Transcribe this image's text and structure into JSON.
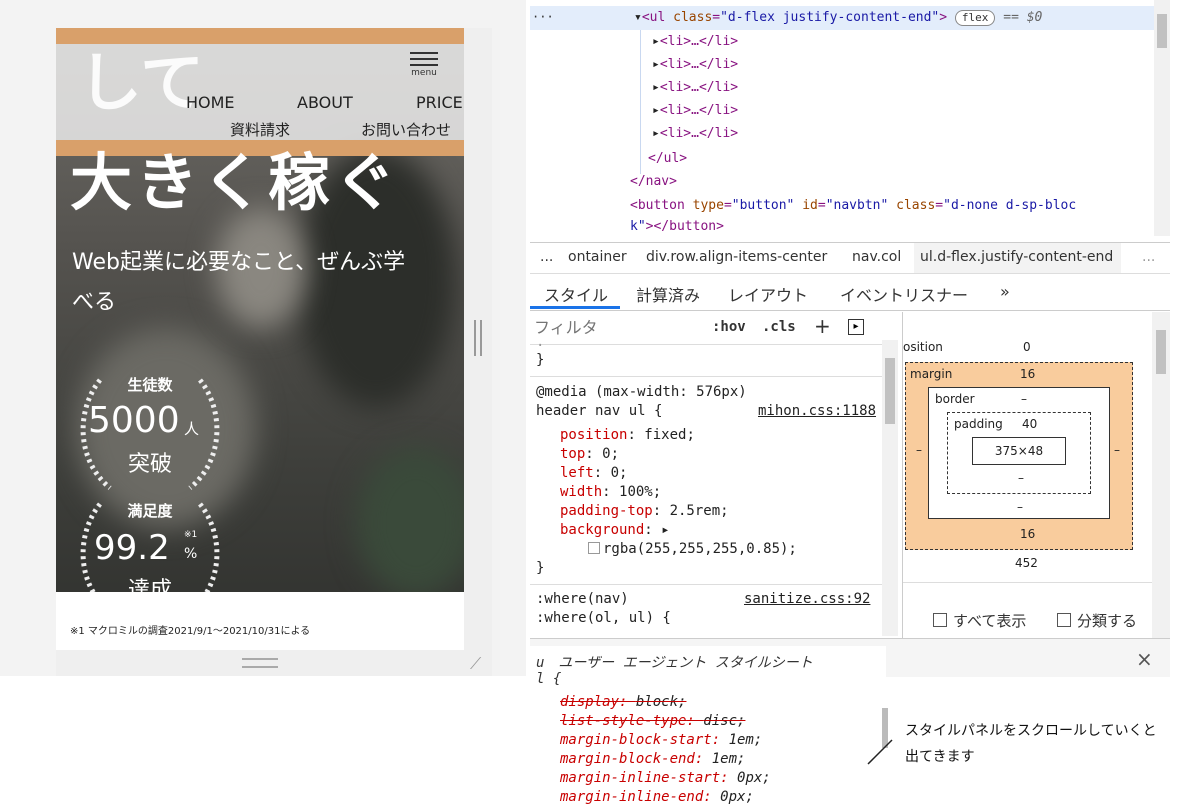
{
  "preview": {
    "hero_line1": "して",
    "hero_line2": "大きく稼ぐ",
    "menu_label": "menu",
    "nav": [
      "HOME",
      "ABOUT",
      "PRICE",
      "資料請求",
      "お問い合わせ"
    ],
    "subtitle_line1": "Web起業に必要なこと、ぜんぶ学",
    "subtitle_line2": "べる",
    "stat1": {
      "label": "生徒数",
      "value": "5000",
      "unit": "人",
      "caption": "突破"
    },
    "stat2": {
      "label": "満足度",
      "value": "99.2",
      "note": "※1",
      "unit": "%",
      "caption": "達成"
    },
    "footnote": "※1 マクロミルの調査2021/9/1～2021/10/31による"
  },
  "devtools": {
    "dom_tree": {
      "dots": "···",
      "ul_open_tag": "ul",
      "ul_class_attr": "class",
      "ul_class_val": "\"d-flex justify-content-end\"",
      "flex_badge": "flex",
      "eq": "== $0",
      "li_items": [
        "<li>…</li>",
        "<li>…</li>",
        "<li>…</li>",
        "<li>…</li>",
        "<li>…</li>"
      ],
      "ul_close": "</ul>",
      "nav_close": "</nav>",
      "button_open": "<button",
      "button_type_attr": "type",
      "button_type_val": "\"button\"",
      "button_id_attr": "id",
      "button_id_val": "\"navbtn\"",
      "button_class_attr": "class",
      "button_class_val": "\"d-none d-sp-bloc",
      "button_class_cont": "k\"",
      "button_close": "></button>"
    },
    "breadcrumb": [
      "...",
      "ontainer",
      "div.row.align-items-center",
      "nav.col",
      "ul.d-flex.justify-content-end",
      "..."
    ],
    "tabs": [
      "スタイル",
      "計算済み",
      "レイアウト",
      "イベントリスナー",
      "»"
    ],
    "filter_placeholder": "フィルタ",
    "hov": ":hov",
    "cls": ".cls",
    "plus": "+",
    "styles": {
      "prev_close": "}",
      "media": "@media (max-width: 576px)",
      "selector": "header nav ul {",
      "source": "mihon.css:1188",
      "props": [
        {
          "name": "position",
          "value": "fixed;"
        },
        {
          "name": "top",
          "value": "0;"
        },
        {
          "name": "left",
          "value": "0;"
        },
        {
          "name": "width",
          "value": "100%;"
        },
        {
          "name": "padding-top",
          "value": "2.5rem;"
        },
        {
          "name": "background",
          "value": "▸"
        }
      ],
      "bg_value": "rgba(255,255,255,0.85);",
      "close": "}",
      "where1": ":where(nav)",
      "where_source": "sanitize.css:92",
      "where2": ":where(ol, ul) {"
    },
    "box_model": {
      "position_label": "osition",
      "position_val": "0",
      "margin_label": "margin",
      "margin_val": "16",
      "border_label": "border",
      "border_val": "–",
      "padding_label": "padding",
      "padding_val": "40",
      "content": "375×48",
      "dash": "–",
      "margin_bottom": "16",
      "width": "452",
      "show_all": "すべて表示",
      "group": "分類する"
    },
    "ua": {
      "header": "u　ユーザー エージェント スタイルシート",
      "selector": "l {",
      "close_icon": "×",
      "lines": [
        {
          "name": "display",
          "value": "block;",
          "struck": true
        },
        {
          "name": "list-style-type",
          "value": "disc;",
          "struck": true
        },
        {
          "name": "margin-block-start",
          "value": "1em;",
          "struck": false
        },
        {
          "name": "margin-block-end",
          "value": "1em;",
          "struck": false
        },
        {
          "name": "margin-inline-start",
          "value": "0px;",
          "struck": false
        },
        {
          "name": "margin-inline-end",
          "value": "0px;",
          "struck": false
        }
      ]
    }
  },
  "annotation": {
    "line1": "スタイルパネルをスクロールしていくと",
    "line2": "出てきます"
  },
  "colors": {
    "accent_band": "#d9a06a",
    "margin_box": "#f9cc9d",
    "selected_row": "#e3edfb"
  }
}
